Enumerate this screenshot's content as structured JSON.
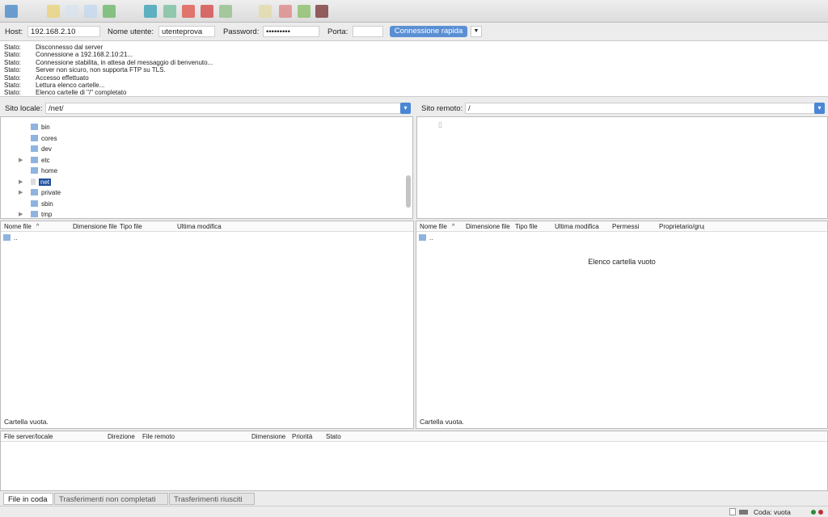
{
  "toolbar": {
    "icons": [
      "site-manager-icon",
      "message-log-icon",
      "local-tree-icon",
      "remote-tree-icon",
      "transfer-queue-icon",
      "refresh-icon",
      "process-queue-icon",
      "cancel-icon",
      "disconnect-icon",
      "reconnect-icon",
      "directory-filter-icon",
      "compare-icon",
      "sync-browse-icon",
      "search-icon"
    ]
  },
  "quickconnect": {
    "host_label": "Host:",
    "host": "192.168.2.10",
    "user_label": "Nome utente:",
    "user": "utenteprova",
    "password_label": "Password:",
    "password": "•••••••••",
    "port_label": "Porta:",
    "port": "",
    "button": "Connessione rapida",
    "dropdown": "▼"
  },
  "log": [
    {
      "k": "Stato:",
      "v": "Disconnesso dal server"
    },
    {
      "k": "Stato:",
      "v": "Connessione a 192.168.2.10:21..."
    },
    {
      "k": "Stato:",
      "v": "Connessione stabilita, in attesa del messaggio di benvenuto..."
    },
    {
      "k": "Stato:",
      "v": "Server non sicuro, non supporta FTP su TLS."
    },
    {
      "k": "Stato:",
      "v": "Accesso effettuato"
    },
    {
      "k": "Stato:",
      "v": "Lettura elenco cartelle..."
    },
    {
      "k": "Stato:",
      "v": "Elenco cartelle di \"/\" completato"
    }
  ],
  "local": {
    "site_label": "Sito locale:",
    "path": "/net/",
    "tree": [
      {
        "name": "bin",
        "exp": false
      },
      {
        "name": "cores",
        "exp": false
      },
      {
        "name": "dev",
        "exp": false
      },
      {
        "name": "etc",
        "exp": true
      },
      {
        "name": "home",
        "exp": false
      },
      {
        "name": "net",
        "exp": true
      },
      {
        "name": "private",
        "exp": true
      },
      {
        "name": "sbin",
        "exp": false
      },
      {
        "name": "tmp",
        "exp": true
      }
    ],
    "columns": [
      "Nome file",
      "Dimensione file",
      "Tipo file",
      "Ultima modifica"
    ],
    "rows": [
      ".."
    ],
    "status": "Cartella vuota."
  },
  "remote": {
    "site_label": "Sito remoto:",
    "path": "/",
    "columns": [
      "Nome file",
      "Dimensione file",
      "Tipo file",
      "Ultima modifica",
      "Permessi",
      "Proprietario/gruppo"
    ],
    "rows": [
      ".."
    ],
    "empty": "Elenco cartella vuoto",
    "status": "Cartella vuota."
  },
  "queue": {
    "columns": [
      "File server/locale",
      "Direzione",
      "File remoto",
      "Dimensione",
      "Priorità",
      "Stato"
    ],
    "tabs": [
      "File in coda",
      "Trasferimenti non completati",
      "Trasferimenti riusciti"
    ]
  },
  "statusbar": {
    "queue": "Coda: vuota",
    "colors": {
      "green": "#2e8b3a",
      "red": "#c0303a"
    }
  }
}
